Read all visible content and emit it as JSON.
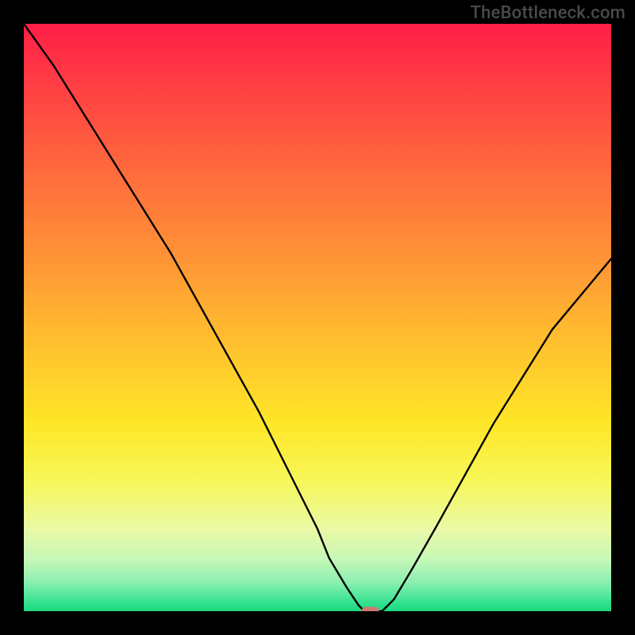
{
  "watermark": "TheBottleneck.com",
  "gradient_stops": [
    {
      "offset": 0.0,
      "color": "#ff1e46"
    },
    {
      "offset": 0.1,
      "color": "#ff3d44"
    },
    {
      "offset": 0.25,
      "color": "#ff6a3d"
    },
    {
      "offset": 0.4,
      "color": "#ff9436"
    },
    {
      "offset": 0.55,
      "color": "#ffc22e"
    },
    {
      "offset": 0.68,
      "color": "#ffe627"
    },
    {
      "offset": 0.78,
      "color": "#f7f85a"
    },
    {
      "offset": 0.86,
      "color": "#eaf9a6"
    },
    {
      "offset": 0.91,
      "color": "#c8f8b7"
    },
    {
      "offset": 0.95,
      "color": "#8df0b2"
    },
    {
      "offset": 0.985,
      "color": "#35e290"
    },
    {
      "offset": 1.0,
      "color": "#18d97f"
    }
  ],
  "chart_data": {
    "type": "line",
    "title": "",
    "xlabel": "",
    "ylabel": "",
    "xlim": [
      0,
      100
    ],
    "ylim": [
      0,
      100
    ],
    "x": [
      0,
      5,
      10,
      15,
      20,
      25,
      30,
      35,
      40,
      45,
      50,
      52,
      55,
      57,
      58,
      59,
      60,
      61,
      63,
      66,
      70,
      75,
      80,
      85,
      90,
      95,
      100
    ],
    "values": [
      100,
      93,
      85,
      77,
      69,
      61,
      52,
      43,
      34,
      24,
      14,
      9,
      4,
      1,
      0,
      0,
      0,
      0,
      2,
      7,
      14,
      23,
      32,
      40,
      48,
      54,
      60
    ],
    "marker": {
      "x": 59,
      "y": 0
    },
    "annotations": []
  }
}
